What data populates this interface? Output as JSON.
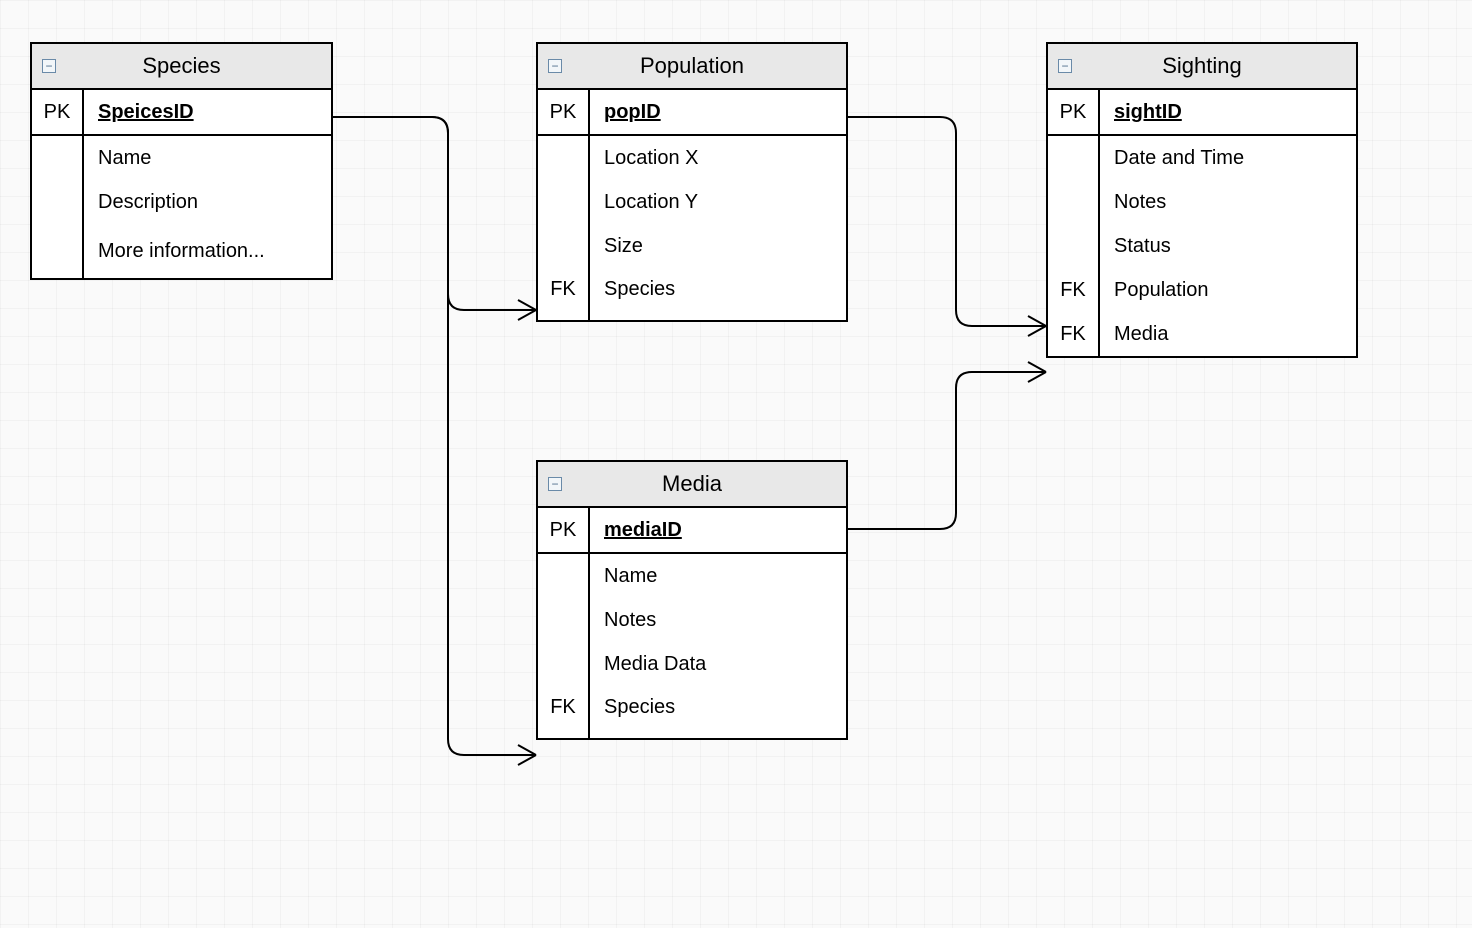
{
  "entities": {
    "species": {
      "title": "Species",
      "pk_label": "PK",
      "pk_field": "SpeicesID",
      "attrs": [
        {
          "key": "",
          "field": "Name"
        },
        {
          "key": "",
          "field": "Description"
        },
        {
          "key": "",
          "field": "More information..."
        }
      ]
    },
    "population": {
      "title": "Population",
      "pk_label": "PK",
      "pk_field": "popID",
      "attrs": [
        {
          "key": "",
          "field": "Location X"
        },
        {
          "key": "",
          "field": "Location Y"
        },
        {
          "key": "",
          "field": "Size"
        },
        {
          "key": "FK",
          "field": "Species"
        }
      ]
    },
    "sighting": {
      "title": "Sighting",
      "pk_label": "PK",
      "pk_field": "sightID",
      "attrs": [
        {
          "key": "",
          "field": "Date and Time"
        },
        {
          "key": "",
          "field": "Notes"
        },
        {
          "key": "",
          "field": "Status"
        },
        {
          "key": "FK",
          "field": "Population"
        },
        {
          "key": "FK",
          "field": "Media"
        }
      ]
    },
    "media": {
      "title": "Media",
      "pk_label": "PK",
      "pk_field": "mediaID",
      "attrs": [
        {
          "key": "",
          "field": "Name"
        },
        {
          "key": "",
          "field": "Notes"
        },
        {
          "key": "",
          "field": "Media Data"
        },
        {
          "key": "FK",
          "field": "Species"
        }
      ]
    }
  },
  "collapse_glyph": "−"
}
